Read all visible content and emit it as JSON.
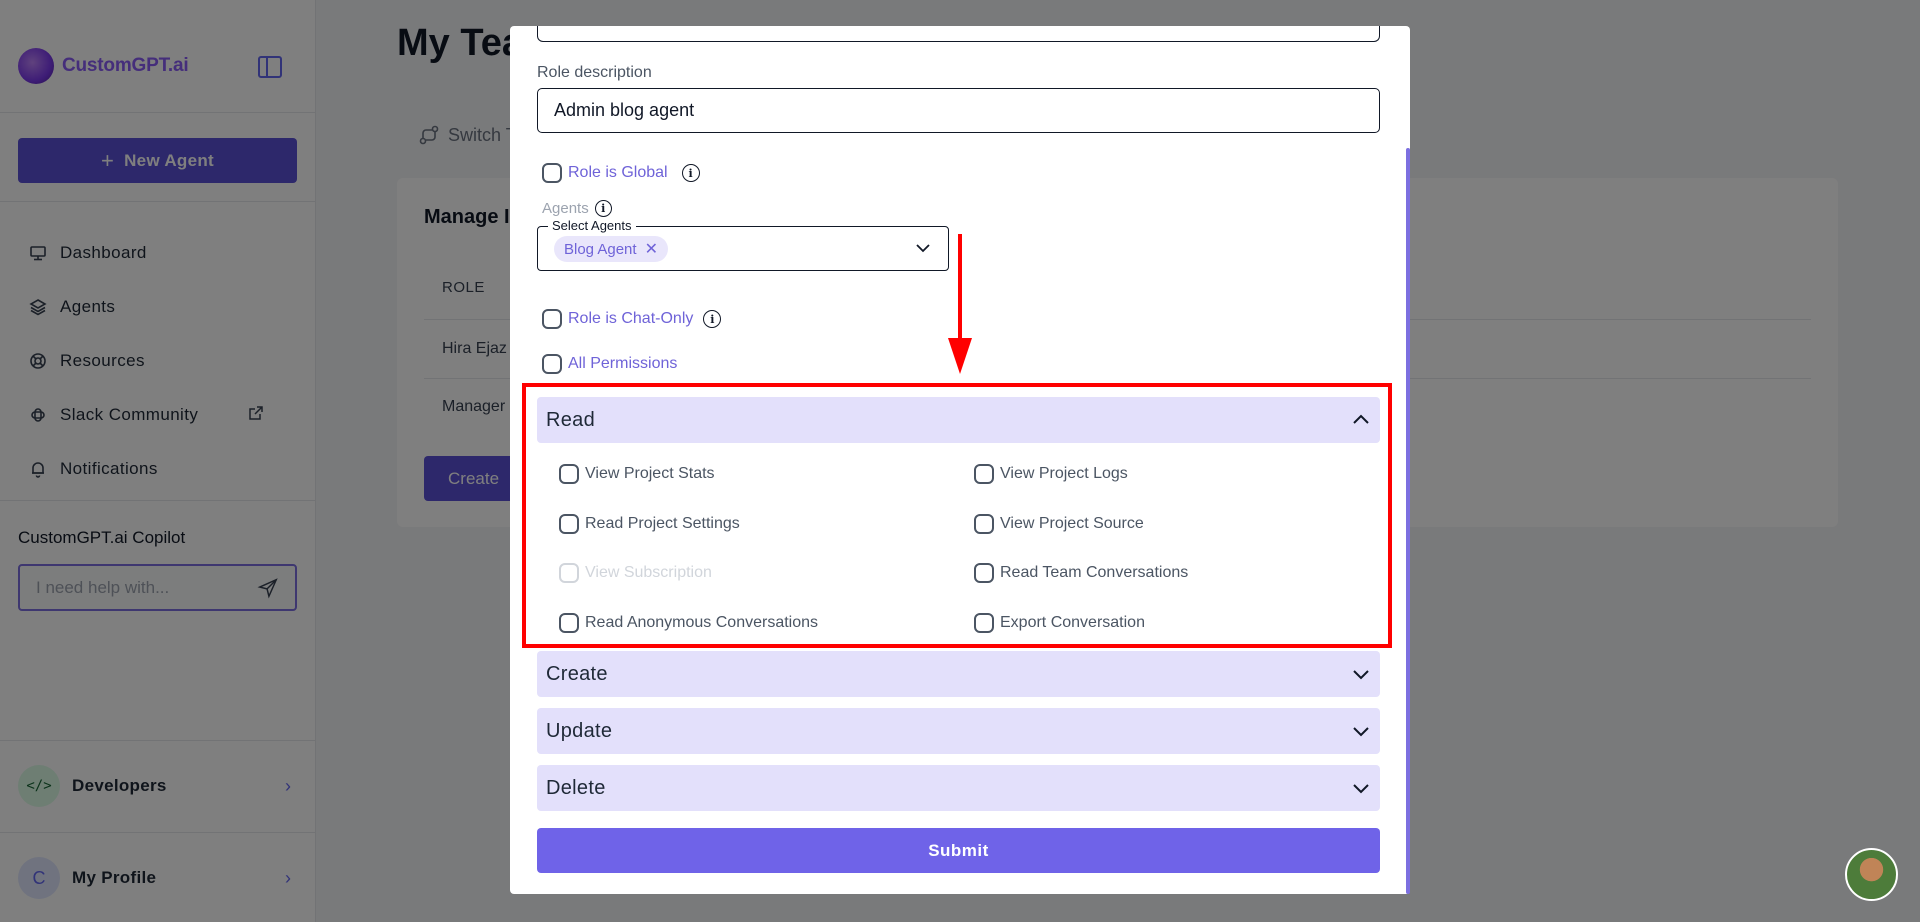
{
  "sidebar": {
    "logo_text": "CustomGPT.ai",
    "new_agent_label": "New Agent",
    "nav": [
      {
        "label": "Dashboard",
        "icon": "monitor-icon"
      },
      {
        "label": "Agents",
        "icon": "layers-icon"
      },
      {
        "label": "Resources",
        "icon": "lifebuoy-icon"
      },
      {
        "label": "Slack Community",
        "icon": "slack-icon"
      },
      {
        "label": "Notifications",
        "icon": "bell-icon"
      }
    ],
    "copilot_title": "CustomGPT.ai Copilot",
    "copilot_placeholder": "I need help with...",
    "developers_label": "Developers",
    "developers_icon_text": "</>",
    "profile_label": "My Profile",
    "profile_initial": "C"
  },
  "main": {
    "page_title": "My Tea",
    "switch_label": "Switch T",
    "card_title": "Manage I",
    "role_header": "ROLE",
    "rows": [
      "Hira Ejaz",
      "Manager"
    ],
    "create_label": "Create"
  },
  "modal": {
    "role_description_label": "Role description",
    "role_description_value": "Admin blog agent",
    "role_global_label": "Role is Global",
    "agents_label": "Agents",
    "select_agents_label": "Select Agents",
    "selected_agent": "Blog Agent",
    "chat_only_label": "Role is Chat-Only",
    "all_permissions_label": "All Permissions",
    "sections": {
      "read": "Read",
      "create": "Create",
      "update": "Update",
      "delete": "Delete"
    },
    "read_permissions": [
      {
        "label": "View Project Stats",
        "disabled": false
      },
      {
        "label": "View Project Logs",
        "disabled": false
      },
      {
        "label": "Read Project Settings",
        "disabled": false
      },
      {
        "label": "View Project Source",
        "disabled": false
      },
      {
        "label": "View Subscription",
        "disabled": true
      },
      {
        "label": "Read Team Conversations",
        "disabled": false
      },
      {
        "label": "Read Anonymous Conversations",
        "disabled": false
      },
      {
        "label": "Export Conversation",
        "disabled": false
      }
    ],
    "submit_label": "Submit"
  },
  "colors": {
    "accent": "#5b50d6",
    "link": "#6f63d8",
    "section_bg": "#e3e0fb",
    "annotation": "#ff0000"
  }
}
